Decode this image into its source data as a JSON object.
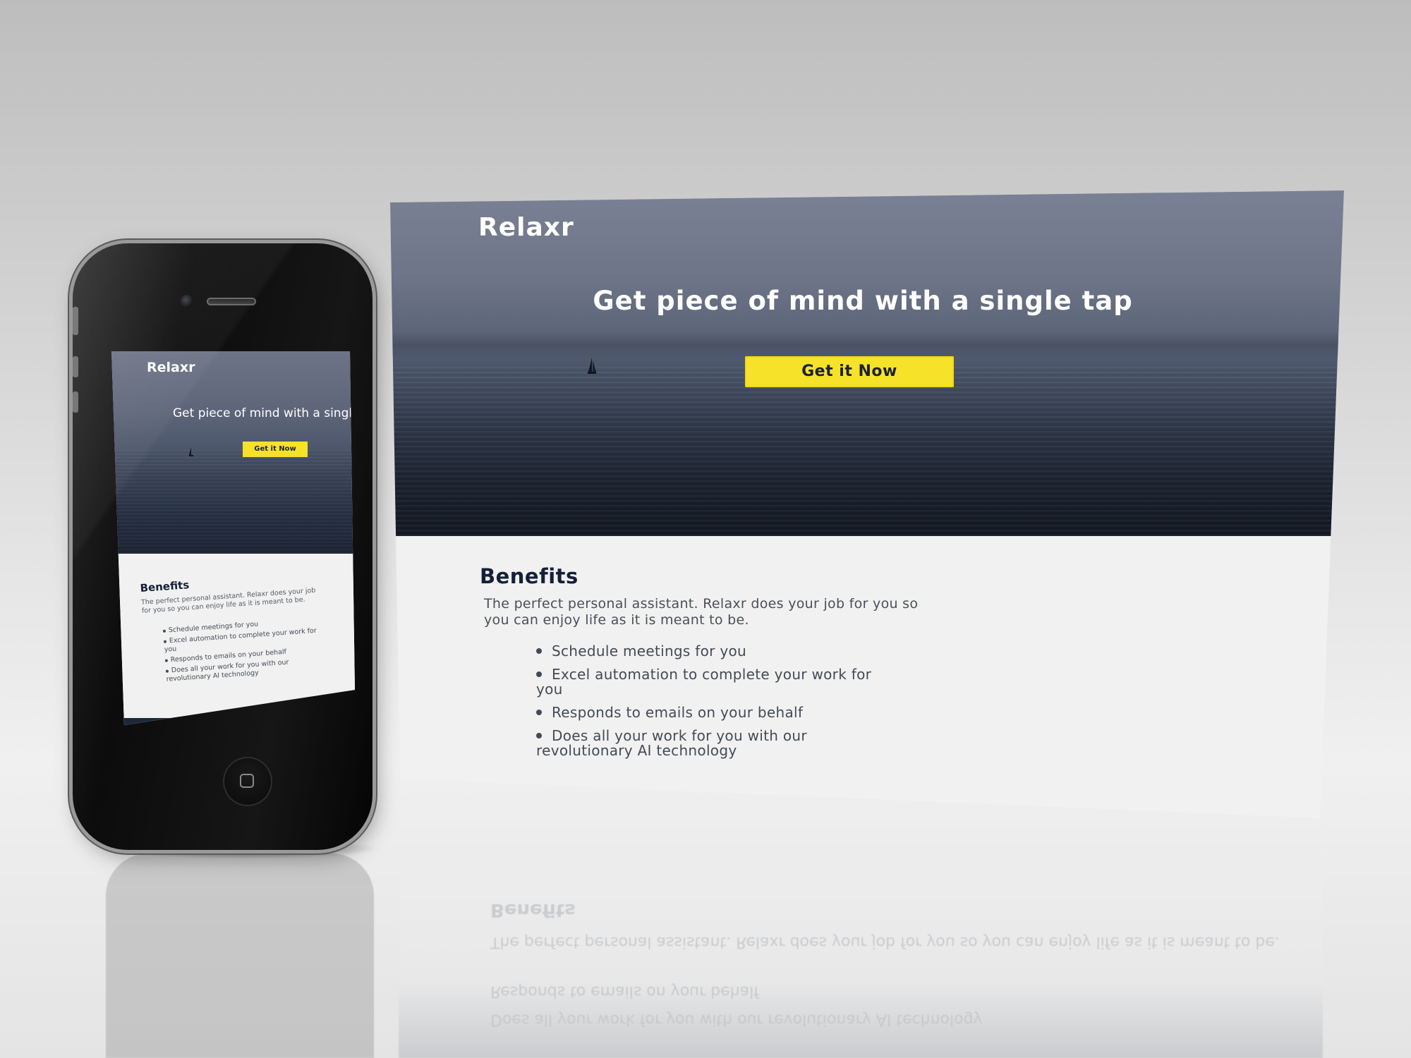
{
  "site": {
    "brand": "Relaxr",
    "headline": "Get piece of mind with a single tap",
    "cta_label": "Get it Now",
    "benefits_title": "Benefits",
    "benefits_description": "The perfect personal assistant. Relaxr does your job for you so you can enjoy life as it is meant to be.",
    "benefits_items": [
      "Schedule meetings for you",
      "Excel automation to complete your work for you",
      "Responds to emails on your behalf",
      "Does all your work for you with our revolutionary AI technology"
    ]
  },
  "mobile": {
    "brand": "Relaxr",
    "headline": "Get piece of mind with a single t",
    "cta_label": "Get it Now",
    "benefits_title": "Benefits",
    "benefits_description": "The perfect personal assistant. Relaxr does your job for you so you can enjoy life as it is meant to be.",
    "benefits_items": [
      "Schedule meetings for you",
      "Excel automation to complete your work for you",
      "Responds to emails on your behalf",
      "Does all your work for you with our revolutionary AI technology"
    ]
  },
  "colors": {
    "cta_yellow": "#f7e22a",
    "heading_navy": "#152038",
    "hero_dark": "#1e2636",
    "body_bg": "#f1f1f1"
  },
  "icons": {
    "boat": "sailboat-icon",
    "home": "home-button-icon",
    "camera": "front-camera-icon",
    "speaker": "earpiece-speaker-icon"
  }
}
